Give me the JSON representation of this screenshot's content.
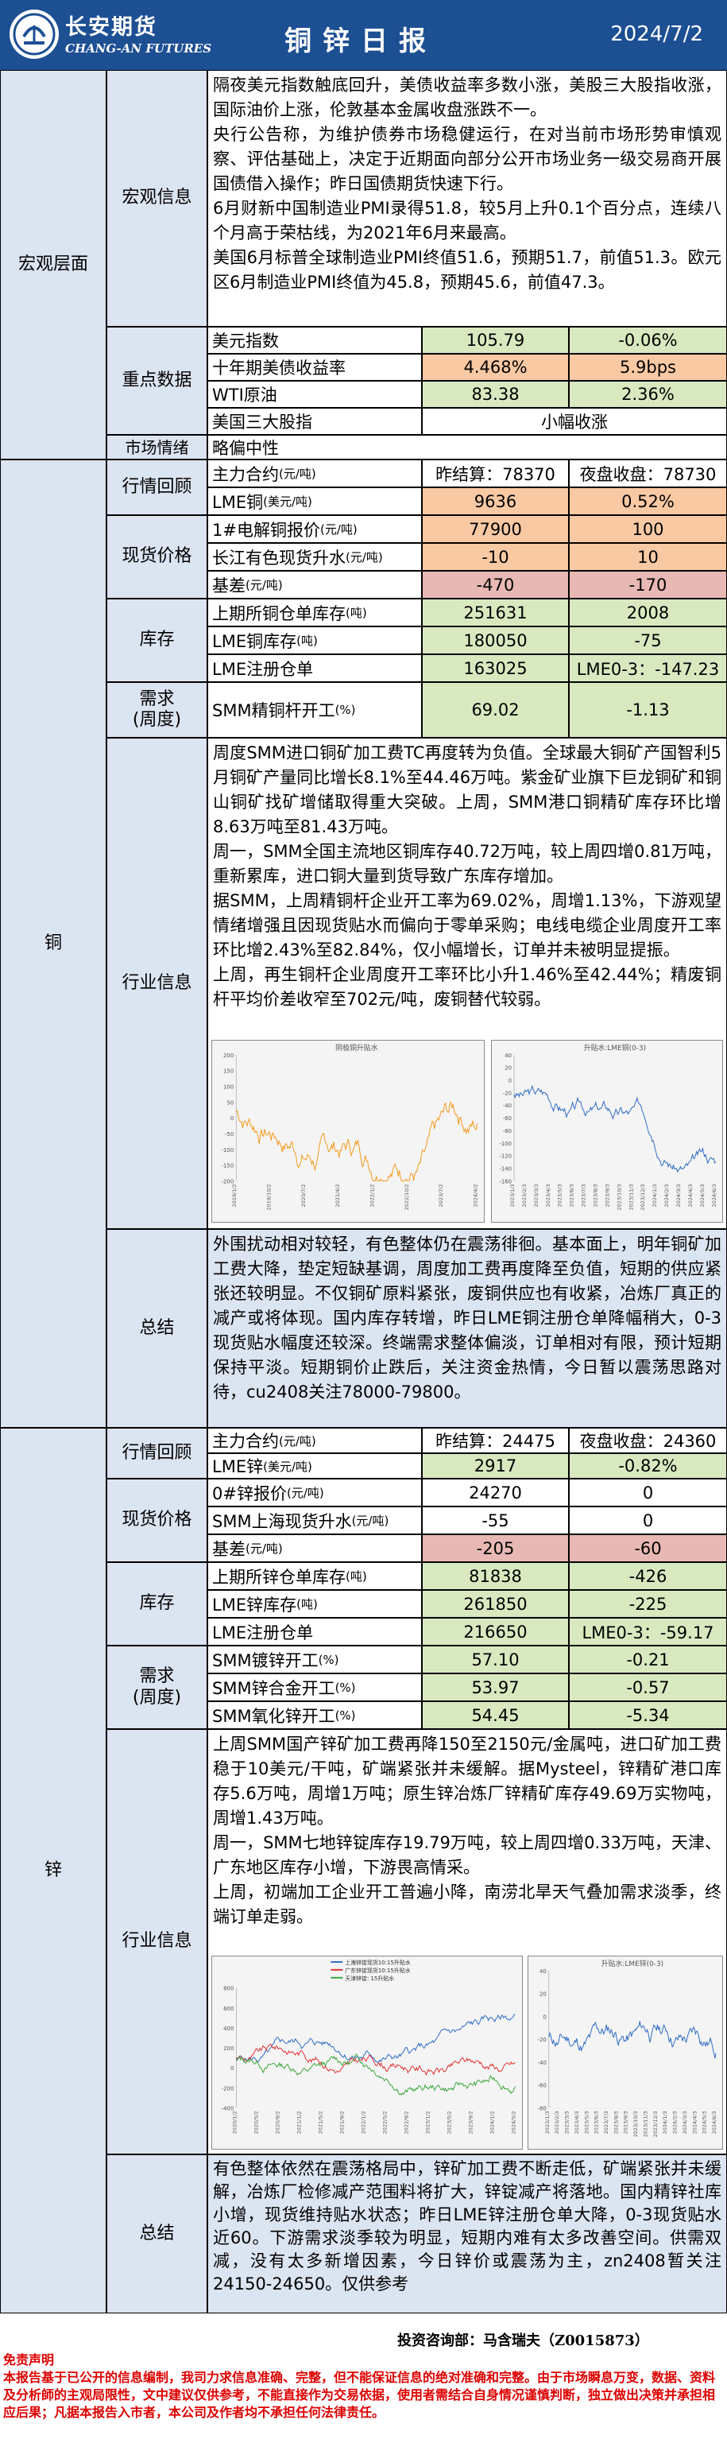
{
  "header": {
    "logo_cn": "长安期货",
    "logo_en": "CHANG-AN FUTURES",
    "title": "铜锌日报",
    "date": "2024/7/2"
  },
  "macro": {
    "section": "宏观层面",
    "info_label": "宏观信息",
    "info_paras": [
      "隔夜美元指数触底回升，美债收益率多数小涨，美股三大股指收涨，国际油价上涨，伦敦基本金属收盘涨跌不一。",
      "央行公告称，为维护债券市场稳健运行，在对当前市场形势审慎观察、评估基础上，决定于近期面向部分公开市场业务一级交易商开展国债借入操作；昨日国债期货快速下行。",
      "6月财新中国制造业PMI录得51.8，较5月上升0.1个百分点，连续八个月高于荣枯线，为2021年6月来最高。",
      "美国6月标普全球制造业PMI终值51.6，预期51.7，前值51.3。欧元区6月制造业PMI终值为45.8，预期45.6，前值47.3。"
    ],
    "key_label": "重点数据",
    "rows": [
      {
        "name": "美元指数",
        "v1": "105.79",
        "v2": "-0.06%"
      },
      {
        "name": "十年期美债收益率",
        "v1": "4.468%",
        "v2": "5.9bps"
      },
      {
        "name": "WTI原油",
        "v1": "83.38",
        "v2": "2.36%"
      },
      {
        "name": "美国三大股指",
        "v1": "小幅收涨"
      }
    ],
    "mood_label": "市场情绪",
    "mood": "略偏中性"
  },
  "copper": {
    "section": "铜",
    "quote_label": "行情回顾",
    "main_contract": "主力合约",
    "unit_yuan_t": "(元/吨)",
    "yest_close": "昨结算：78370",
    "night_close": "夜盘收盘：78730",
    "lme_label": "LME铜",
    "lme_unit": "(美元/吨)",
    "lme_v1": "9636",
    "lme_v2": "0.52%",
    "spot_label": "现货价格",
    "spot_rows": [
      {
        "name": "1#电解铜报价",
        "unit": "(元/吨)",
        "v1": "77900",
        "v2": "100"
      },
      {
        "name": "长江有色现货升水",
        "unit": "(元/吨)",
        "v1": "-10",
        "v2": "10"
      },
      {
        "name": "基差",
        "unit": "(元/吨)",
        "v1": "-470",
        "v2": "-170"
      }
    ],
    "stock_label": "库存",
    "stock_rows": [
      {
        "name": "上期所铜仓单库存",
        "unit": "(吨)",
        "v1": "251631",
        "v2": "2008"
      },
      {
        "name": "LME铜库存",
        "unit": "(吨)",
        "v1": "180050",
        "v2": "-75"
      },
      {
        "name": "LME注册仓单",
        "unit": "",
        "v1": "163025",
        "v2": "LME0-3：-147.23"
      }
    ],
    "demand_label": "需求\n(周度)",
    "demand_rows": [
      {
        "name": "SMM精铜杆开工",
        "unit": "(%)",
        "v1": "69.02",
        "v2": "-1.13"
      }
    ],
    "industry_label": "行业信息",
    "industry_paras": [
      "周度SMM进口铜矿加工费TC再度转为负值。全球最大铜矿产国智利5月铜矿产量同比增长8.1%至44.46万吨。紫金矿业旗下巨龙铜矿和铜山铜矿找矿增储取得重大突破。上周，SMM港口铜精矿库存环比增8.63万吨至81.43万吨。",
      "周一，SMM全国主流地区铜库存40.72万吨，较上周四增0.81万吨，重新累库，进口铜大量到货导致广东库存增加。",
      "据SMM，上周精铜杆企业开工率为69.02%，周增1.13%，下游观望情绪增强且因现货贴水而偏向于零单采购；电线电缆企业周度开工率环比增2.43%至82.84%，仅小幅增长，订单并未被明显提振。",
      "上周，再生铜杆企业周度开工率环比小升1.46%至42.44%；精废铜杆平均价差收窄至702元/吨，废铜替代较弱。"
    ],
    "chart1": {
      "title": "阴极铜升贴水",
      "yticks": [
        "200",
        "150",
        "100",
        "50",
        "0",
        "-50",
        "-100",
        "-150",
        "-200"
      ],
      "xticks": [
        "2019/1/2",
        "2019/10/2",
        "2020/7/2",
        "2021/4/2",
        "2022/1/2",
        "2022/10/2",
        "2023/7/2",
        "2024/4/2"
      ]
    },
    "chart2": {
      "title": "升贴水:LME铜(0-3)",
      "yticks": [
        "40",
        "20",
        "0",
        "-20",
        "-40",
        "-60",
        "-80",
        "-100",
        "-120",
        "-140",
        "-160"
      ],
      "xticks": [
        "2023/1/3",
        "2023/2/3",
        "2023/3/3",
        "2023/4/3",
        "2023/5/3",
        "2023/6/3",
        "2023/7/3",
        "2023/8/3",
        "2023/9/3",
        "2023/10/3",
        "2023/11/3",
        "2023/12/3",
        "2024/1/3",
        "2024/2/3",
        "2024/3/3",
        "2024/4/3",
        "2024/5/3",
        "2024/6/3"
      ]
    },
    "summary_label": "总结",
    "summary": "外围扰动相对较轻，有色整体仍在震荡徘徊。基本面上，明年铜矿加工费大降，垫定短缺基调，周度加工费再度降至负值，短期的供应紧张还较明显。不仅铜矿原料紧张，废铜供应也有收紧，冶炼厂真正的减产或将体现。国内库存转增，昨日LME铜注册仓单降幅稍大，0-3现货贴水幅度还较深。终端需求整体偏淡，订单相对有限，预计短期保持平淡。短期铜价止跌后，关注资金热情，今日暂以震荡思路对待，cu2408关注78000-79800。"
  },
  "zinc": {
    "section": "锌",
    "quote_label": "行情回顾",
    "main_contract": "主力合约",
    "unit_yuan_t": "(元/吨)",
    "yest_close": "昨结算：24475",
    "night_close": "夜盘收盘：24360",
    "lme_label": "LME锌",
    "lme_unit": "(美元/吨)",
    "lme_v1": "2917",
    "lme_v2": "-0.82%",
    "spot_label": "现货价格",
    "spot_rows": [
      {
        "name": "0#锌报价",
        "unit": "(元/吨)",
        "v1": "24270",
        "v2": "0"
      },
      {
        "name": "SMM上海现货升水",
        "unit": "(元/吨)",
        "v1": "-55",
        "v2": "0"
      },
      {
        "name": "基差",
        "unit": "(元/吨)",
        "v1": "-205",
        "v2": "-60"
      }
    ],
    "stock_label": "库存",
    "stock_rows": [
      {
        "name": "上期所锌仓单库存",
        "unit": "(吨)",
        "v1": "81838",
        "v2": "-426"
      },
      {
        "name": "LME锌库存",
        "unit": "(吨)",
        "v1": "261850",
        "v2": "-225"
      },
      {
        "name": "LME注册仓单",
        "unit": "",
        "v1": "216650",
        "v2": "LME0-3：-59.17"
      }
    ],
    "demand_label": "需求\n(周度)",
    "demand_rows": [
      {
        "name": "SMM镀锌开工",
        "unit": "(%)",
        "v1": "57.10",
        "v2": "-0.21"
      },
      {
        "name": "SMM锌合金开工",
        "unit": "(%)",
        "v1": "53.97",
        "v2": "-0.57"
      },
      {
        "name": "SMM氧化锌开工",
        "unit": "(%)",
        "v1": "54.45",
        "v2": "-5.34"
      }
    ],
    "industry_label": "行业信息",
    "industry_paras": [
      "上周SMM国产锌矿加工费再降150至2150元/金属吨，进口矿加工费稳于10美元/干吨，矿端紧张并未缓解。据Mysteel，锌精矿港口库存5.6万吨，周增1万吨；原生锌冶炼厂锌精矿库存49.69万实物吨，周增1.43万吨。",
      "周一，SMM七地锌锭库存19.79万吨，较上周四增0.33万吨，天津、广东地区库存小增，下游畏高情采。",
      "上周，初端加工企业开工普遍小降，南涝北旱天气叠加需求淡季，终端订单走弱。"
    ],
    "chart3": {
      "legend": [
        "上海锌锭现货10:15升贴水",
        "广东锌锭现货10:15升贴水",
        "天津锌锭: 15升贴水"
      ],
      "yticks": [
        "800",
        "600",
        "400",
        "200",
        "0",
        "-200",
        "-400"
      ],
      "xticks": [
        "2020/1/2",
        "2020/5/2",
        "2020/9/2",
        "2021/1/2",
        "2021/5/2",
        "2021/9/2",
        "2022/1/2",
        "2022/5/2",
        "2022/9/2",
        "2023/1/2",
        "2023/5/2",
        "2023/9/2",
        "2024/1/2",
        "2024/5/2"
      ]
    },
    "chart4": {
      "title": "升贴水:LME锌(0-3)",
      "yticks": [
        "40",
        "20",
        "0",
        "-20",
        "-40",
        "-60",
        "-80"
      ],
      "xticks": [
        "2023/1/3",
        "2023/2/3",
        "2023/3/3",
        "2023/4/3",
        "2023/5/3",
        "2023/6/3",
        "2023/7/3",
        "2023/8/3",
        "2023/9/3",
        "2023/10/3",
        "2023/11/3",
        "2023/12/3",
        "2024/1/3",
        "2024/2/3",
        "2024/3/3",
        "2024/4/3",
        "2024/5/3",
        "2024/6/3"
      ]
    },
    "summary_label": "总结",
    "summary": "有色整体依然在震荡格局中，锌矿加工费不断走低，矿端紧张并未缓解，冶炼厂检修减产范围料将扩大，锌锭减产将落地。国内精锌社库小增，现货维持贴水状态；昨日LME锌注册仓单大降，0-3现货贴水近60。下游需求淡季较为明显，短期内难有太多改善空间。供需双减，没有太多新增因素，今日锌价或震荡为主，zn2408暂关注24150-24650。仅供参考"
  },
  "footer": {
    "contact": "投资咨询部：马含瑞夫（Z0015873）",
    "disclaimer_title": "免责声明",
    "disclaimer": "本报告基于已公开的信息编制，我司力求信息准确、完整，但不能保证信息的绝对准确和完整。由于市场瞬息万变，数据、资料及分析師的主观局限性，文中建议仅供参考，不能直接作为交易依据，使用者需结合自身情况谨慎判断，独立做出决策并承担相应后果；凡据本报告入市者，本公司及作者均不承担任何法律责任。"
  },
  "colors": {
    "header_bg": "#1d4f93",
    "label_bg": "#dbe4f1",
    "green": "#d8e9c0",
    "orange": "#f9c9a4",
    "pink": "#e8b9b4",
    "line_orange": "#f39a1b",
    "line_blue": "#2f6cc4",
    "line_red": "#e03030",
    "line_green": "#3aa63a"
  }
}
